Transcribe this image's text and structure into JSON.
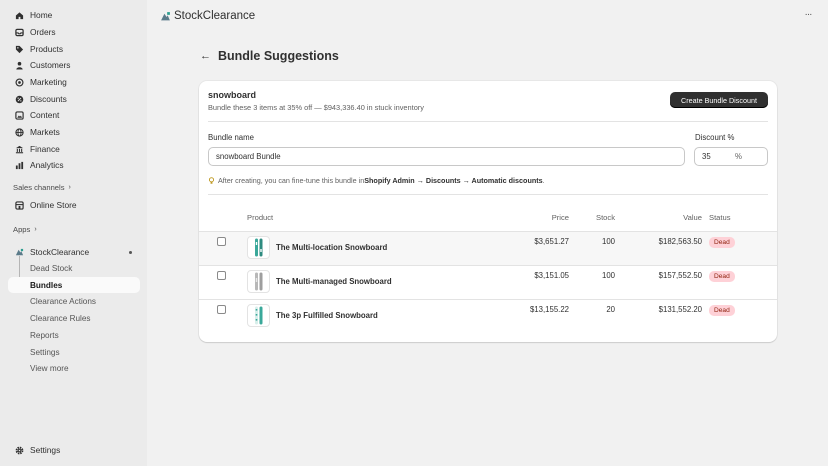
{
  "sidebar": {
    "items": [
      {
        "label": "Home",
        "icon": "home-icon"
      },
      {
        "label": "Orders",
        "icon": "orders-icon"
      },
      {
        "label": "Products",
        "icon": "tag-icon"
      },
      {
        "label": "Customers",
        "icon": "person-icon"
      },
      {
        "label": "Marketing",
        "icon": "target-icon"
      },
      {
        "label": "Discounts",
        "icon": "discount-icon"
      },
      {
        "label": "Content",
        "icon": "content-icon"
      },
      {
        "label": "Markets",
        "icon": "globe-icon"
      },
      {
        "label": "Finance",
        "icon": "bank-icon"
      },
      {
        "label": "Analytics",
        "icon": "chart-icon"
      }
    ],
    "sales_channels_label": "Sales channels",
    "online_store_label": "Online Store",
    "apps_label": "Apps",
    "app_name": "StockClearance",
    "app_subitems": [
      "Dead Stock",
      "Bundles",
      "Clearance Actions",
      "Clearance Rules",
      "Reports",
      "Settings",
      "View more"
    ],
    "settings_label": "Settings"
  },
  "topbar": {
    "app_title": "StockClearance",
    "more_label": "···"
  },
  "page": {
    "back_label": "←",
    "title": "Bundle Suggestions"
  },
  "card": {
    "title": "snowboard",
    "subtitle": "Bundle these 3 items at 35% off — $943,336.40 in stuck inventory",
    "create_button": "Create Bundle Discount",
    "bundle_name_label": "Bundle name",
    "bundle_name_value": "snowboard Bundle",
    "discount_label": "Discount %",
    "discount_value": "35",
    "discount_suffix": "%",
    "hint_prefix": "After creating, you can fine-tune this bundle in ",
    "hint_path": "Shopify Admin → Discounts → Automatic discounts",
    "hint_suffix": "."
  },
  "table": {
    "headers": {
      "product": "Product",
      "price": "Price",
      "stock": "Stock",
      "value": "Value",
      "status": "Status"
    },
    "rows": [
      {
        "name": "The Multi-location Snowboard",
        "price": "$3,651.27",
        "stock": "100",
        "value": "$182,563.50",
        "status": "Dead"
      },
      {
        "name": "The Multi-managed Snowboard",
        "price": "$3,151.05",
        "stock": "100",
        "value": "$157,552.50",
        "status": "Dead"
      },
      {
        "name": "The 3p Fulfilled Snowboard",
        "price": "$13,155.22",
        "stock": "20",
        "value": "$131,552.20",
        "status": "Dead"
      }
    ]
  },
  "colors": {
    "primary_button": "#303030",
    "badge_bg": "#fed1d7",
    "badge_text": "#8e1f0b",
    "sidebar_bg": "#ebebeb",
    "main_bg": "#f1f1f1"
  }
}
